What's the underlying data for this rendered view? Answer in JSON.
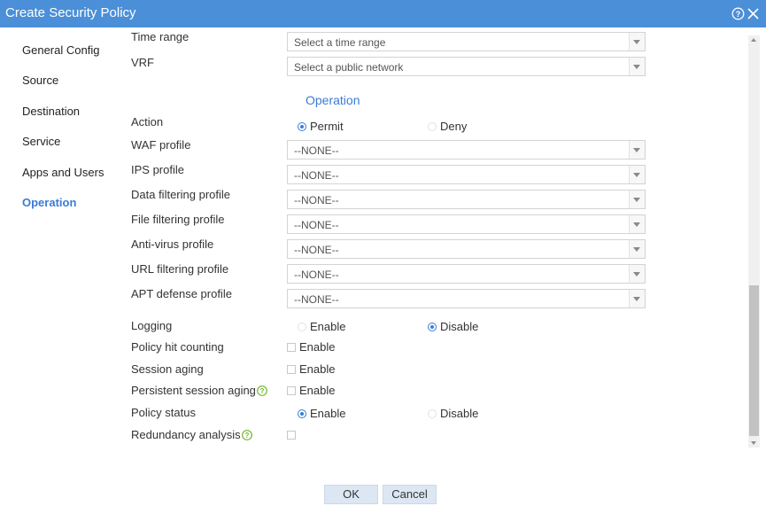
{
  "window": {
    "title": "Create Security Policy"
  },
  "nav": {
    "items": [
      {
        "label": "General Config",
        "active": false
      },
      {
        "label": "Source",
        "active": false
      },
      {
        "label": "Destination",
        "active": false
      },
      {
        "label": "Service",
        "active": false
      },
      {
        "label": "Apps and Users",
        "active": false
      },
      {
        "label": "Operation",
        "active": true
      }
    ]
  },
  "form": {
    "time_range": {
      "label": "Time range",
      "placeholder": "Select a time range"
    },
    "vrf": {
      "label": "VRF",
      "placeholder": "Select a public network"
    },
    "section_title": "Operation",
    "action": {
      "label": "Action",
      "options": [
        "Permit",
        "Deny"
      ],
      "selected": "Permit"
    },
    "profiles": [
      {
        "label": "WAF profile",
        "value": "--NONE--"
      },
      {
        "label": "IPS profile",
        "value": "--NONE--"
      },
      {
        "label": "Data filtering profile",
        "value": "--NONE--"
      },
      {
        "label": "File filtering profile",
        "value": "--NONE--"
      },
      {
        "label": "Anti-virus profile",
        "value": "--NONE--"
      },
      {
        "label": "URL filtering profile",
        "value": "--NONE--"
      },
      {
        "label": "APT defense profile",
        "value": "--NONE--"
      }
    ],
    "logging": {
      "label": "Logging",
      "options": [
        "Enable",
        "Disable"
      ],
      "selected": "Disable"
    },
    "policy_hit_counting": {
      "label": "Policy hit counting",
      "option": "Enable",
      "checked": false
    },
    "session_aging": {
      "label": "Session aging",
      "option": "Enable",
      "checked": false
    },
    "persistent_session_aging": {
      "label": "Persistent session aging",
      "option": "Enable",
      "checked": false
    },
    "policy_status": {
      "label": "Policy status",
      "options": [
        "Enable",
        "Disable"
      ],
      "selected": "Enable"
    },
    "redundancy_analysis": {
      "label": "Redundancy analysis",
      "checked": false
    }
  },
  "buttons": {
    "ok": "OK",
    "cancel": "Cancel"
  },
  "colors": {
    "titlebar": "#4a8fd8",
    "accent": "#3a7bd5",
    "help_icon": "#6fb52c"
  },
  "icons": {
    "help": "question-circle-icon",
    "close": "close-icon",
    "field_help": "help-icon"
  }
}
